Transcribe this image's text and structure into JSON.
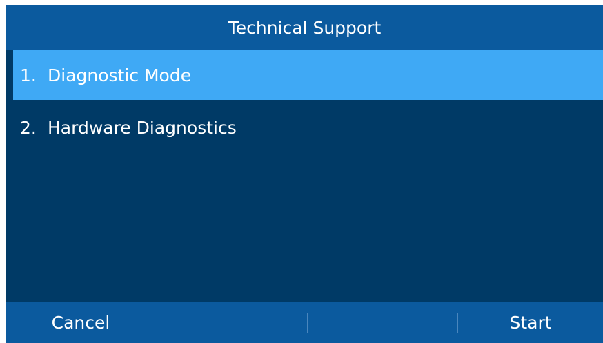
{
  "title": "Technical Support",
  "menu": {
    "items": [
      {
        "number": "1.",
        "label": "Diagnostic Mode",
        "selected": true
      },
      {
        "number": "2.",
        "label": "Hardware Diagnostics",
        "selected": false
      }
    ]
  },
  "softkeys": {
    "left": "Cancel",
    "mid1": "",
    "mid2": "",
    "right": "Start"
  },
  "colors": {
    "background": "#003a66",
    "bars": "#0b5a9e",
    "selection": "#3fa9f5",
    "text": "#ffffff"
  }
}
